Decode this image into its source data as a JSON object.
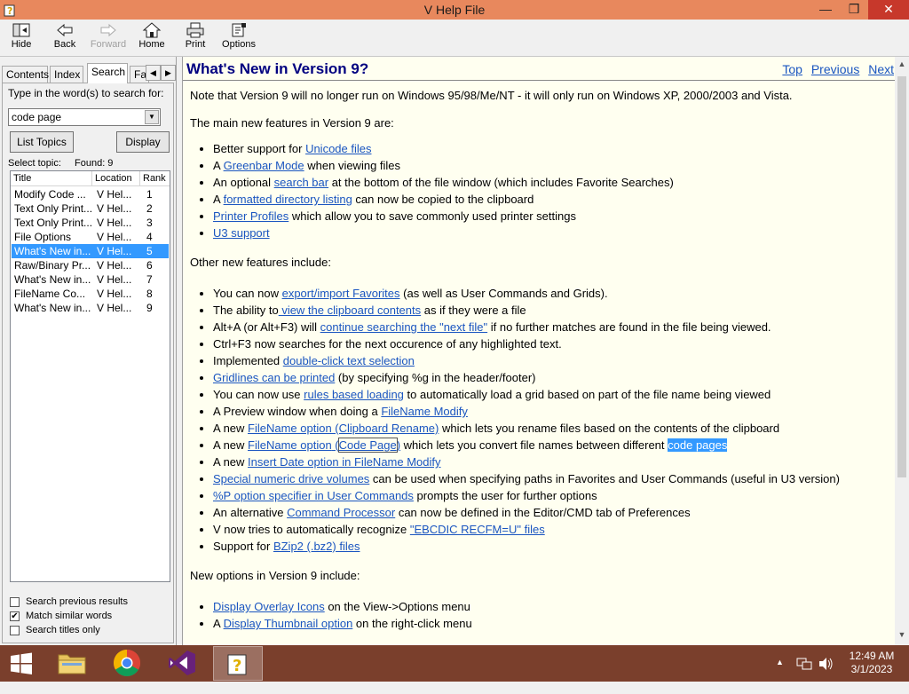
{
  "window": {
    "title": "V Help File",
    "minimize": "—",
    "maximize": "❒",
    "close": "✕"
  },
  "toolbar": {
    "hide": "Hide",
    "back": "Back",
    "forward": "Forward",
    "home": "Home",
    "print": "Print",
    "options": "Options"
  },
  "left": {
    "tabs": [
      "Contents",
      "Index",
      "Search",
      "Fa"
    ],
    "tab_prev": "◀",
    "tab_next": "▶",
    "prompt": "Type in the word(s) to search for:",
    "search_value": "code page",
    "list_topics": "List Topics",
    "display": "Display",
    "select_topic": "Select topic:",
    "found": "Found: 9",
    "columns": [
      "Title",
      "Location",
      "Rank"
    ],
    "results": [
      {
        "title": "Modify Code ...",
        "location": "V Hel...",
        "rank": "1"
      },
      {
        "title": "Text Only Print...",
        "location": "V Hel...",
        "rank": "2"
      },
      {
        "title": "Text Only Print...",
        "location": "V Hel...",
        "rank": "3"
      },
      {
        "title": "File Options",
        "location": "V Hel...",
        "rank": "4"
      },
      {
        "title": "What's New in...",
        "location": "V Hel...",
        "rank": "5"
      },
      {
        "title": "Raw/Binary Pr...",
        "location": "V Hel...",
        "rank": "6"
      },
      {
        "title": "What's New in...",
        "location": "V Hel...",
        "rank": "7"
      },
      {
        "title": "FileName Co...",
        "location": "V Hel...",
        "rank": "8"
      },
      {
        "title": "What's New in...",
        "location": "V Hel...",
        "rank": "9"
      }
    ],
    "selected_index": 4,
    "search_previous": "Search previous results",
    "match_similar": "Match similar words",
    "search_titles": "Search titles only",
    "checkmark": "✔"
  },
  "content": {
    "heading": "What's New in Version 9?",
    "nav": {
      "top": "Top",
      "previous": "Previous",
      "next": "Next"
    },
    "intro": "Note that Version 9 will no longer run on Windows 95/98/Me/NT - it will only run on Windows XP, 2000/2003 and Vista.",
    "main_features_heading": "The main new features in Version 9 are:",
    "other_features_heading": "Other new features include:",
    "new_options_heading": "New options in Version 9 include:",
    "t": {
      "m1a": "Better support for ",
      "m1l": "Unicode files",
      "m2a": "A ",
      "m2l": "Greenbar Mode",
      "m2b": " when viewing files",
      "m3a": "An optional ",
      "m3l": "search bar",
      "m3b": " at the bottom of the file window (which includes Favorite Searches)",
      "m4a": "A ",
      "m4l": "formatted directory listing",
      "m4b": " can now be copied to the clipboard",
      "m5l": "Printer Profiles",
      "m5b": " which allow you to save commonly used printer settings",
      "m6l": "U3 support",
      "o1a": "You can now ",
      "o1l": "export/import Favorites",
      "o1b": " (as well as User Commands and Grids).",
      "o2a": "The ability to",
      "o2l": " view the clipboard contents",
      "o2b": " as if they were a file",
      "o3a": "Alt+A (or Alt+F3) will ",
      "o3l": "continue searching the \"next file\"",
      "o3b": " if no further matches are found in the file being viewed.",
      "o4": "Ctrl+F3 now searches for the next occurence of any highlighted text.",
      "o5a": "Implemented ",
      "o5l": "double-click text selection",
      "o6l": "Gridlines can be printed",
      "o6b": " (by specifying %g in the header/footer)",
      "o7a": "You can now use ",
      "o7l": "rules based loading",
      "o7b": " to automatically load a grid based on part of the file name being viewed",
      "o8a": "A Preview window when doing a ",
      "o8l": "FileName Modify",
      "o9a": "A new ",
      "o9l": "FileName option (Clipboard Rename)",
      "o9b": " which lets you rename files based on the contents of the clipboard",
      "o10a": "A new ",
      "o10l1": "FileName option",
      "o10l2": " (",
      "o10l3": "Code Page",
      "o10l4": ")",
      "o10b": " which lets you convert file names between different ",
      "o10c": "code pages",
      "o11a": "A new ",
      "o11l": "Insert Date option in FileName Modify",
      "o12l": "Special numeric drive volumes",
      "o12b": " can be used when specifying paths in Favorites and User Commands (useful in U3 version)",
      "o13l": "%P option specifier in User Commands",
      "o13b": " prompts the user for further options",
      "o14a": "An alternative ",
      "o14l": "Command Processor",
      "o14b": " can now be defined in the Editor/CMD tab of Preferences",
      "o15a": "V now tries to automatically recognize ",
      "o15l": "\"EBCDIC RECFM=U\" files",
      "o16a": "Support for ",
      "o16l": "BZip2 (.bz2) files",
      "n1l": "Display Overlay Icons",
      "n1b": " on the View->Options menu",
      "n2a": "A ",
      "n2l": "Display Thumbnail option",
      "n2b": " on the right-click menu"
    }
  },
  "taskbar": {
    "time": "12:49 AM",
    "date": "3/1/2023"
  },
  "colors": {
    "titlebar": "#e8885d",
    "taskbar": "#7a3f2c",
    "link": "#1a55c0",
    "selection": "#3399ff",
    "heading": "#000080"
  }
}
